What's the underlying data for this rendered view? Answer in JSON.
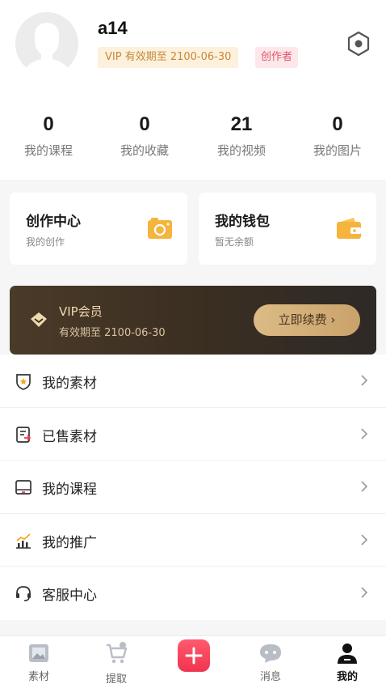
{
  "profile": {
    "username": "a14",
    "vip_badge": "VIP 有效期至 2100-06-30",
    "creator_badge": "创作者"
  },
  "stats": [
    {
      "value": "0",
      "label": "我的课程"
    },
    {
      "value": "0",
      "label": "我的收藏"
    },
    {
      "value": "21",
      "label": "我的视频"
    },
    {
      "value": "0",
      "label": "我的图片"
    }
  ],
  "cards": {
    "creation": {
      "title": "创作中心",
      "subtitle": "我的创作"
    },
    "wallet": {
      "title": "我的钱包",
      "subtitle": "暂无余额"
    }
  },
  "vip_banner": {
    "title": "VIP会员",
    "subtitle": "有效期至 2100-06-30",
    "button": "立即续费 ›"
  },
  "menu": [
    {
      "label": "我的素材",
      "icon": "star-badge-icon"
    },
    {
      "label": "已售素材",
      "icon": "sold-document-icon"
    },
    {
      "label": "我的课程",
      "icon": "course-icon"
    },
    {
      "label": "我的推广",
      "icon": "chart-icon"
    },
    {
      "label": "客服中心",
      "icon": "headset-icon"
    }
  ],
  "bottom_nav": [
    {
      "label": "素材",
      "icon": "image-icon"
    },
    {
      "label": "提取",
      "icon": "cart-icon"
    },
    {
      "label": "",
      "icon": "plus-icon"
    },
    {
      "label": "消息",
      "icon": "message-icon"
    },
    {
      "label": "我的",
      "icon": "user-icon",
      "active": true
    }
  ],
  "colors": {
    "accent": "#f0344f",
    "vip_gold": "#c9a26a",
    "card_icon": "#f5b43c"
  }
}
